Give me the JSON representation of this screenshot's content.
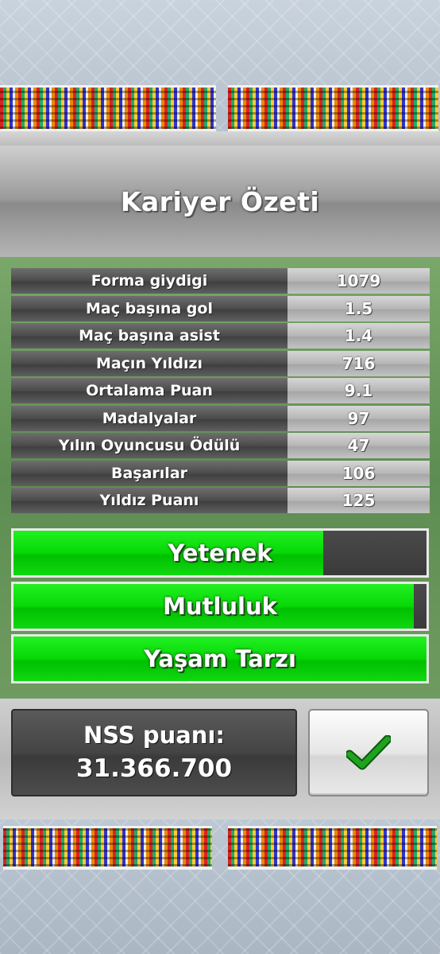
{
  "title": "Kariyer Özeti",
  "stats": [
    {
      "label": "Forma giydigi",
      "value": "1079"
    },
    {
      "label": "Maç başına gol",
      "value": "1.5"
    },
    {
      "label": "Maç başına asist",
      "value": "1.4"
    },
    {
      "label": "Maçın Yıldızı",
      "value": "716"
    },
    {
      "label": "Ortalama Puan",
      "value": "9.1"
    },
    {
      "label": "Madalyalar",
      "value": "97"
    },
    {
      "label": "Yılın Oyuncusu Ödülü",
      "value": "47"
    },
    {
      "label": "Başarılar",
      "value": "106"
    },
    {
      "label": "Yıldız Puanı",
      "value": "125"
    }
  ],
  "bars": [
    {
      "label": "Yetenek",
      "fill_fraction": 0.75
    },
    {
      "label": "Mutluluk",
      "fill_fraction": 0.97
    },
    {
      "label": "Yaşam Tarzı",
      "fill_fraction": 1.0
    }
  ],
  "score": {
    "label": "NSS puanı:",
    "value": "31.366.700"
  },
  "confirm_icon": "checkmark-icon",
  "colors": {
    "bar_fill": "#06d806",
    "bar_track": "#3f3f3f",
    "check": "#1fa31f"
  }
}
